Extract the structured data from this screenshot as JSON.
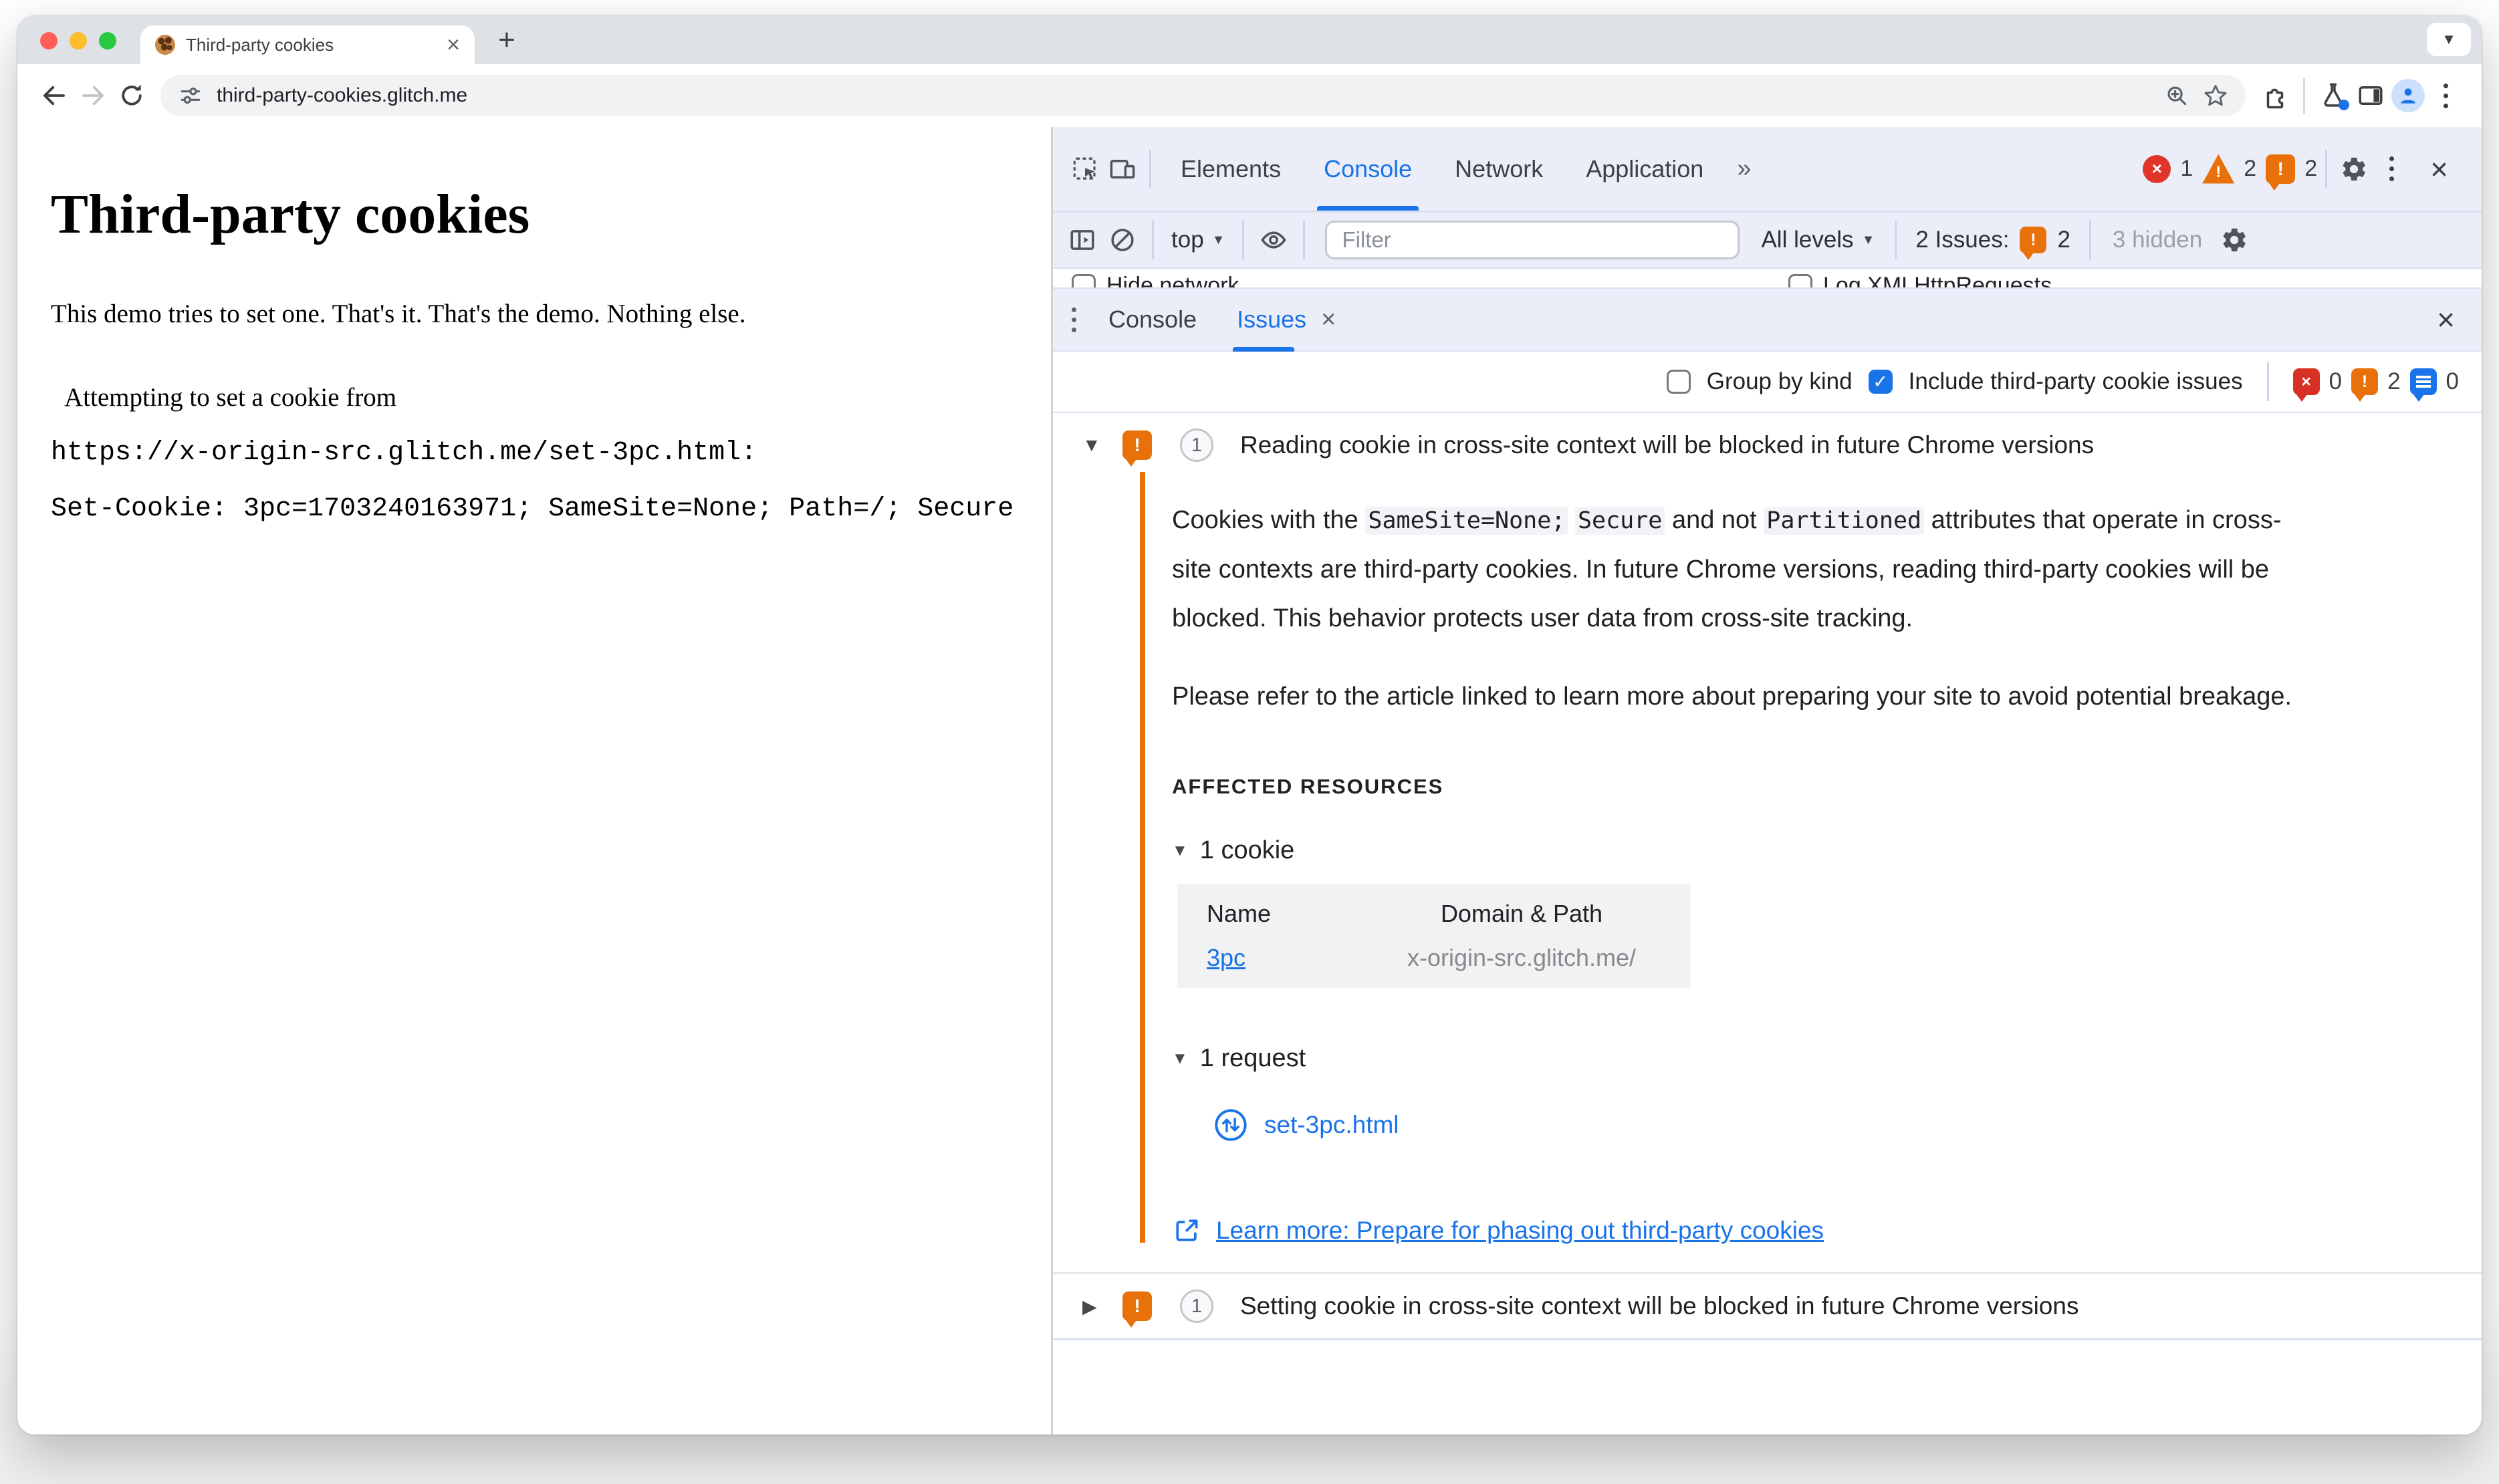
{
  "browser": {
    "tab_title": "Third-party cookies",
    "url": "third-party-cookies.glitch.me"
  },
  "icons": {
    "close": "×",
    "plus": "+",
    "more_tabs": "»",
    "caret_down": "▼",
    "caret_right": "▶",
    "check": "✓",
    "chevron_down": "▼",
    "error_x": "×",
    "bang": "!"
  },
  "page": {
    "heading": "Third-party cookies",
    "intro": "This demo tries to set one. That's it. That's the demo. Nothing else.",
    "attempt_prefix": "Attempting to set a cookie from",
    "attempt_url": "https://x-origin-src.glitch.me/set-3pc.html:",
    "set_cookie_line": "Set-Cookie: 3pc=1703240163971; SameSite=None; Path=/; Secure"
  },
  "devtools": {
    "main_tabs": [
      {
        "label": "Elements"
      },
      {
        "label": "Console"
      },
      {
        "label": "Network"
      },
      {
        "label": "Application"
      }
    ],
    "status": {
      "errors": "1",
      "warnings": "2",
      "issues": "2"
    },
    "console_toolbar": {
      "context": "top",
      "filter_placeholder": "Filter",
      "levels": "All levels",
      "issues_label": "2 Issues:",
      "issues_count": "2",
      "hidden": "3 hidden"
    },
    "settings_peek": {
      "left": "Hide network",
      "right": "Log XMLHttpRequests"
    },
    "drawer": {
      "console_tab": "Console",
      "issues_tab": "Issues"
    },
    "issues_toolbar": {
      "group_by_kind": "Group by kind",
      "include_third_party": "Include third-party cookie issues",
      "errors": "0",
      "warnings": "2",
      "info": "0"
    },
    "issue_reading": {
      "count": "1",
      "title": "Reading cookie in cross-site context will be blocked in future Chrome versions",
      "p1_s1": "Cookies with the ",
      "p1_c1": "SameSite=None;",
      "p1_s2": " ",
      "p1_c2": "Secure",
      "p1_s3": " and not ",
      "p1_c3": "Partitioned",
      "p1_s4": " attributes that operate in cross-site contexts are third-party cookies. In future Chrome versions, reading third-party cookies will be blocked. This behavior protects user data from cross-site tracking.",
      "p2": "Please refer to the article linked to learn more about preparing your site to avoid potential breakage.",
      "affected_heading": "AFFECTED RESOURCES",
      "cookie_group": "1 cookie",
      "table": {
        "headers": [
          "Name",
          "Domain & Path"
        ],
        "rows": [
          [
            "3pc",
            "x-origin-src.glitch.me/"
          ]
        ]
      },
      "request_group": "1 request",
      "request_file": "set-3pc.html",
      "learn_more": "Learn more: Prepare for phasing out third-party cookies"
    },
    "issue_setting": {
      "count": "1",
      "title": "Setting cookie in cross-site context will be blocked in future Chrome versions"
    }
  },
  "colors": {
    "accent_blue": "#1a73e8",
    "warning_orange": "#e8710a",
    "error_red": "#d93025"
  }
}
